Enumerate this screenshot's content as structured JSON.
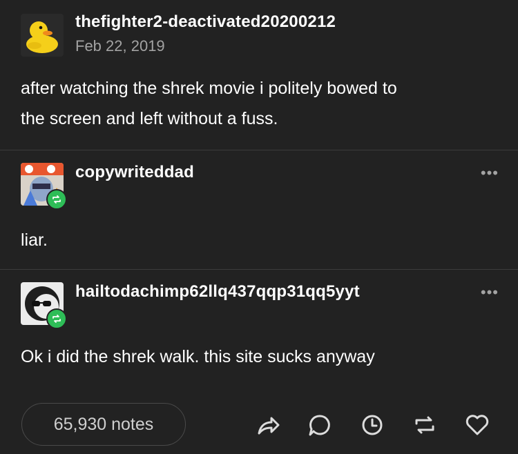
{
  "post": {
    "author": "thefighter2-deactivated20200212",
    "date": "Feb 22, 2019",
    "text_line1": "after watching the shrek movie i politely bowed to",
    "text_line2": "the screen and left without a fuss."
  },
  "reblogs": [
    {
      "author": "copywriteddad",
      "text": "liar.",
      "more": "•••"
    },
    {
      "author": "hailtodachimp62llq437qqp31qq5yyt",
      "text": "Ok i did the shrek walk. this site sucks anyway",
      "more": "•••"
    }
  ],
  "footer": {
    "notes": "65,930 notes",
    "actions": [
      "share-icon",
      "reply-icon",
      "history-icon",
      "reblog-icon",
      "like-icon"
    ]
  },
  "colors": {
    "background": "#222222",
    "text": "#ffffff",
    "muted": "#a3a3a3",
    "reblog_green": "#2ebd57"
  }
}
